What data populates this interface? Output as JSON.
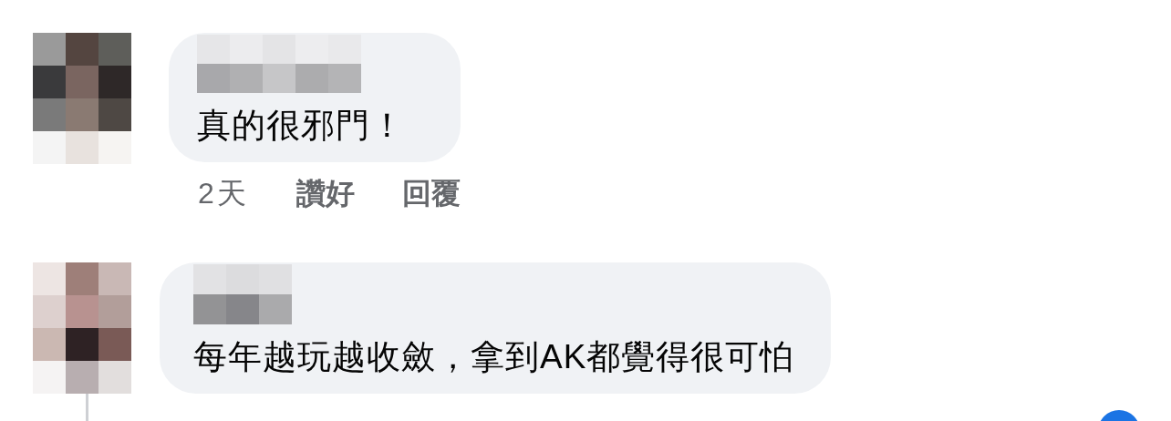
{
  "comments": [
    {
      "text": "真的很邪門！",
      "time": "2天",
      "like": "讚好",
      "reply": "回覆",
      "thread_line": false
    },
    {
      "text": "每年越玩越收斂，拿到AK都覺得很可怕",
      "thread_line": true
    }
  ]
}
